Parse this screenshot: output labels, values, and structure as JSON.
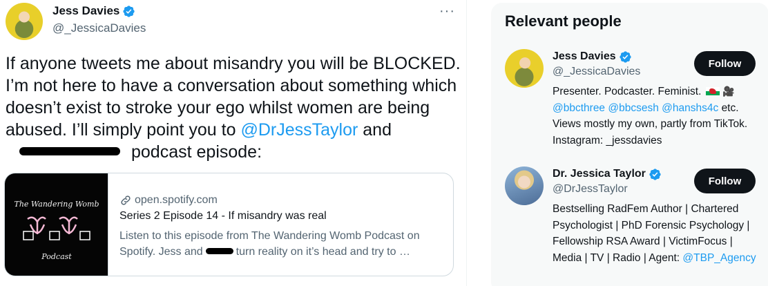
{
  "tweet": {
    "author_name": "Jess Davies",
    "author_handle": "@_JessicaDavies",
    "more_label": "···",
    "text_segments": {
      "part1": "If anyone tweets me about misandry you will be BLOCKED. I’m not here to have a conversation about something which doesn’t exist to stroke your ego whilst women are being abused. I’ll simply point you to ",
      "mention": "@DrJessTaylor",
      "and": " and",
      "part2": "podcast episode:"
    },
    "card": {
      "image_title": "The Wandering Womb",
      "image_subtitle": "Podcast",
      "domain": "open.spotify.com",
      "title": "Series 2 Episode 14 - If misandry was real",
      "desc_part1": "Listen to this episode from The Wandering Womb Podcast on Spotify. Jess and",
      "desc_part2": "turn reality on it’s head and try to …"
    }
  },
  "sidebar": {
    "title": "Relevant people",
    "people": [
      {
        "name": "Jess Davies",
        "handle": "@_JessicaDavies",
        "follow_label": "Follow",
        "bio_line1": "Presenter. Podcaster. Feminist.",
        "bio_camera": "🎥",
        "bio_m1": "@bbcthree",
        "bio_m2": "@bbcsesh",
        "bio_m3": "@hanshs4c",
        "bio_rest": "etc. Views mostly my own, partly from TikTok. Instagram: _jessdavies"
      },
      {
        "name": "Dr. Jessica Taylor",
        "handle": "@DrJessTaylor",
        "follow_label": "Follow",
        "bio_text": "Bestselling RadFem Author | Chartered Psychologist | PhD Forensic Psychology | Fellowship RSA Award | VictimFocus | Media | TV | Radio | Agent: ",
        "bio_mention": "@TBP_Agency"
      }
    ]
  },
  "colors": {
    "accent": "#1d9bf0",
    "text": "#0f1419",
    "secondary": "#536471",
    "button": "#0f1419"
  }
}
